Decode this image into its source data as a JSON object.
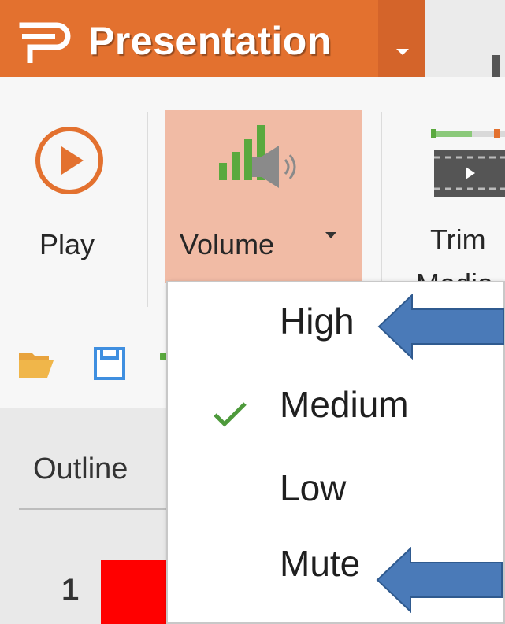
{
  "titlebar": {
    "app_name": "Presentation",
    "logo_icon": "presentation-logo-icon",
    "dropdown_icon": "caret-down-icon",
    "accent_color": "#e3712f"
  },
  "ribbon": {
    "play": {
      "label": "Play",
      "icon": "play-circle-icon"
    },
    "volume": {
      "label": "Volume",
      "icon": "volume-speaker-icon",
      "active_color": "#f1bba5"
    },
    "trim": {
      "label_line1": "Trim",
      "label_line2": "Media",
      "icon": "trim-video-icon"
    }
  },
  "quick_access": {
    "open_icon": "folder-open-icon",
    "save_icon": "save-floppy-icon"
  },
  "left_panel": {
    "tab_label": "Outline",
    "slide_number": "1",
    "thumb_color": "#ff0000"
  },
  "volume_menu": {
    "items": [
      {
        "label": "High",
        "checked": false
      },
      {
        "label": "Medium",
        "checked": true
      },
      {
        "label": "Low",
        "checked": false
      },
      {
        "label": "Mute",
        "checked": false
      }
    ],
    "check_color": "#4e9a3c",
    "annotation_arrow_color": "#4a7ab8"
  }
}
